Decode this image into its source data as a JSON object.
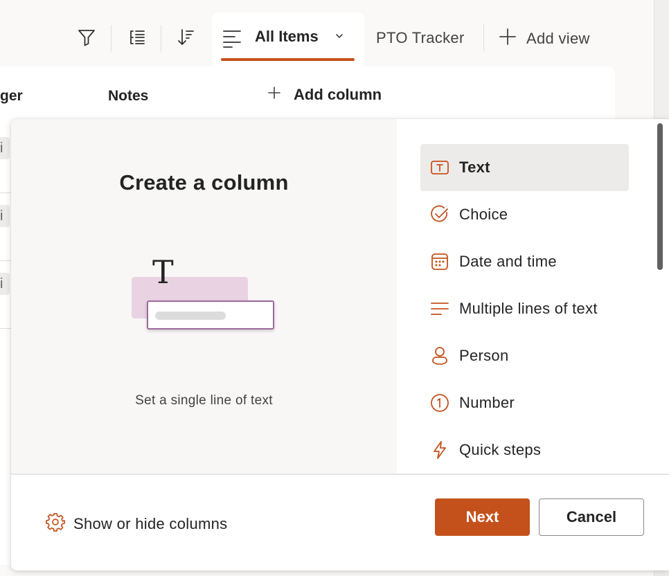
{
  "toolbar": {
    "active_view": "All Items",
    "other_view": "PTO Tracker",
    "add_view_label": "Add view"
  },
  "list": {
    "columns": [
      "ger",
      "Notes"
    ],
    "add_column_label": "Add column",
    "row_fragments": [
      "i S",
      "i S",
      "i S"
    ]
  },
  "panel": {
    "preview": {
      "title": "Create a column",
      "description": "Set a single line of text"
    },
    "column_types": [
      {
        "label": "Text",
        "icon": "text-box-icon",
        "selected": true
      },
      {
        "label": "Choice",
        "icon": "checkmark-circle-icon",
        "selected": false
      },
      {
        "label": "Date and time",
        "icon": "calendar-icon",
        "selected": false
      },
      {
        "label": "Multiple lines of text",
        "icon": "text-lines-icon",
        "selected": false
      },
      {
        "label": "Person",
        "icon": "person-icon",
        "selected": false
      },
      {
        "label": "Number",
        "icon": "number-circle-icon",
        "selected": false
      },
      {
        "label": "Quick steps",
        "icon": "flash-icon",
        "selected": false
      }
    ],
    "footer": {
      "show_hide_label": "Show or hide columns",
      "next_label": "Next",
      "cancel_label": "Cancel"
    }
  },
  "colors": {
    "accent": "#c4511c",
    "selected_bg": "#edebe9",
    "illustration_pink": "#e9d3e3"
  }
}
